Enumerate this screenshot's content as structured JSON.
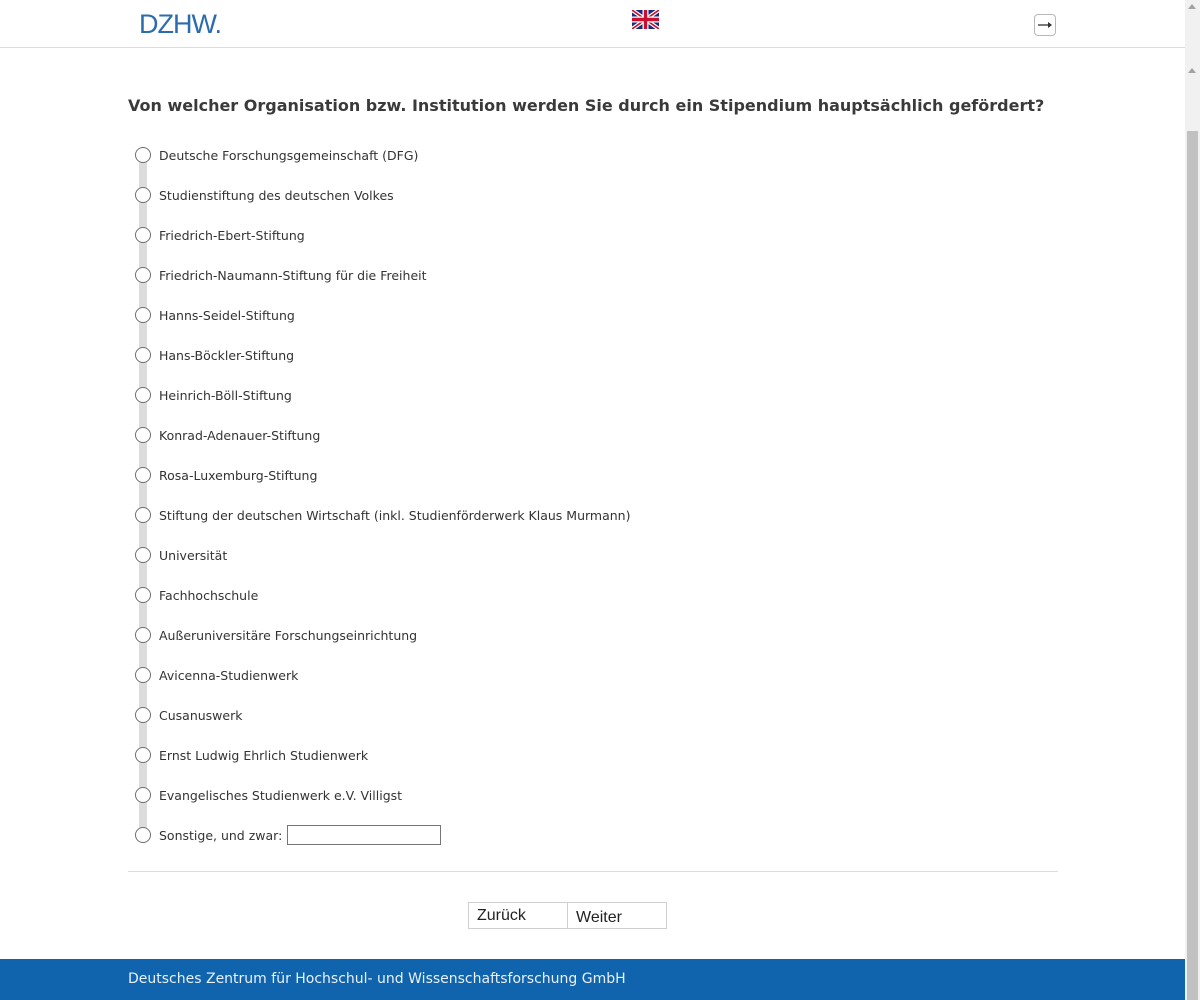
{
  "header": {
    "logo_text": "DZHW.",
    "language_flag_icon": "uk-flag-icon",
    "exit_icon": "exit-arrow-icon"
  },
  "question": {
    "text": "Von welcher Organisation bzw. Institution werden Sie durch ein Stipendium hauptsächlich gefördert?"
  },
  "options": [
    {
      "label": "Deutsche Forschungsgemeinschaft (DFG)"
    },
    {
      "label": "Studienstiftung des deutschen Volkes"
    },
    {
      "label": "Friedrich-Ebert-Stiftung"
    },
    {
      "label": "Friedrich-Naumann-Stiftung für die Freiheit"
    },
    {
      "label": "Hanns-Seidel-Stiftung"
    },
    {
      "label": "Hans-Böckler-Stiftung"
    },
    {
      "label": "Heinrich-Böll-Stiftung"
    },
    {
      "label": "Konrad-Adenauer-Stiftung"
    },
    {
      "label": "Rosa-Luxemburg-Stiftung"
    },
    {
      "label": "Stiftung der deutschen Wirtschaft (inkl. Studienförderwerk Klaus Murmann)"
    },
    {
      "label": "Universität"
    },
    {
      "label": "Fachhochschule"
    },
    {
      "label": "Außeruniversitäre Forschungseinrichtung"
    },
    {
      "label": "Avicenna-Studienwerk"
    },
    {
      "label": "Cusanuswerk"
    },
    {
      "label": "Ernst Ludwig Ehrlich Studienwerk"
    },
    {
      "label": "Evangelisches Studienwerk e.V. Villigst"
    },
    {
      "label": "Sonstige, und zwar:"
    }
  ],
  "other_input": {
    "value": ""
  },
  "navigation": {
    "back_label": "Zurück",
    "next_label": "Weiter"
  },
  "footer": {
    "text": "Deutsches Zentrum für Hochschul- und Wissenschaftsforschung GmbH"
  },
  "colors": {
    "brand_blue": "#0f64ad",
    "logo_blue": "#2b6bb0"
  }
}
